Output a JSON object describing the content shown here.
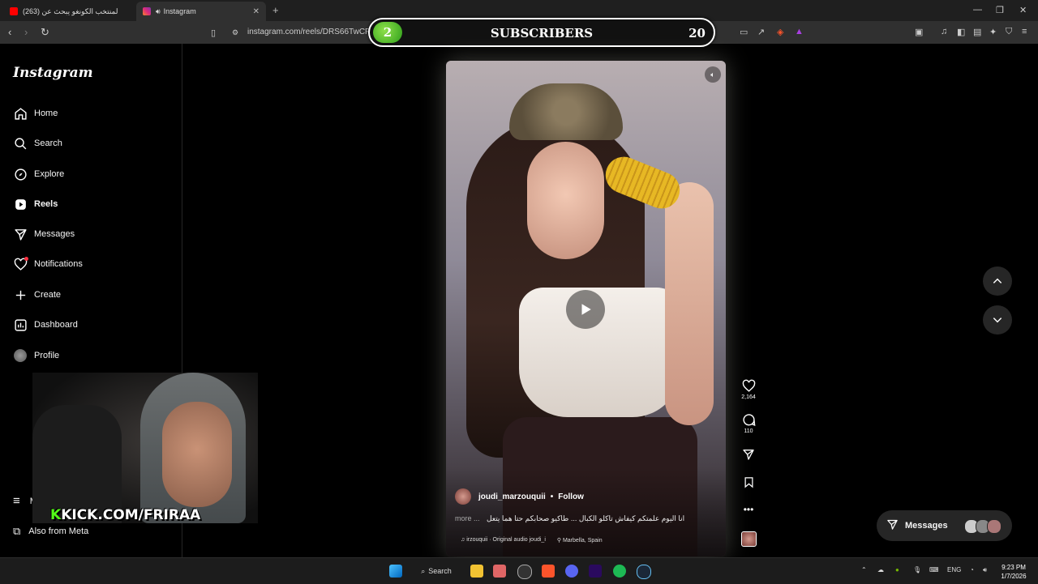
{
  "browser": {
    "tabs": [
      {
        "label": "(263) مشجع لمنتخب الكونغو يبحث عن",
        "favicon_color": "#ff0000"
      },
      {
        "label": "Instagram",
        "favicon_color": "#e1306c"
      }
    ],
    "url": "instagram.com/reels/DRS66TwCPLF"
  },
  "overlay": {
    "count": "2",
    "label": "SUBSCRIBERS",
    "goal": "20"
  },
  "instagram": {
    "logo": "Instagram",
    "nav": [
      {
        "label": "Home",
        "icon": "home-icon"
      },
      {
        "label": "Search",
        "icon": "search-icon"
      },
      {
        "label": "Explore",
        "icon": "compass-icon"
      },
      {
        "label": "Reels",
        "icon": "reels-icon"
      },
      {
        "label": "Messages",
        "icon": "send-icon"
      },
      {
        "label": "Notifications",
        "icon": "heart-icon"
      },
      {
        "label": "Create",
        "icon": "plus-icon"
      },
      {
        "label": "Dashboard",
        "icon": "chart-icon"
      },
      {
        "label": "Profile",
        "icon": "avatar-icon"
      }
    ],
    "more_label": "M",
    "also_from_meta": "Also from Meta",
    "reel": {
      "author": "joudi_marzouquii",
      "follow": "Follow",
      "caption": "انا اليوم علمتكم كيفاش تاكلو الكبال ... طاكيو صحابكم حتا هما يتعل",
      "more": "more ...",
      "audio": "irzouquii · Original audio  joudi_i",
      "location": "Marbella, Spain",
      "likes": "2,164",
      "comments": "110"
    },
    "messages_label": "Messages"
  },
  "stream": {
    "kick_text": "KICK.COM/FRIRAA",
    "kick_k": "K"
  },
  "taskbar": {
    "search_label": "Search",
    "language": "ENG",
    "time": "9:23 PM",
    "date": "1/7/2026"
  }
}
